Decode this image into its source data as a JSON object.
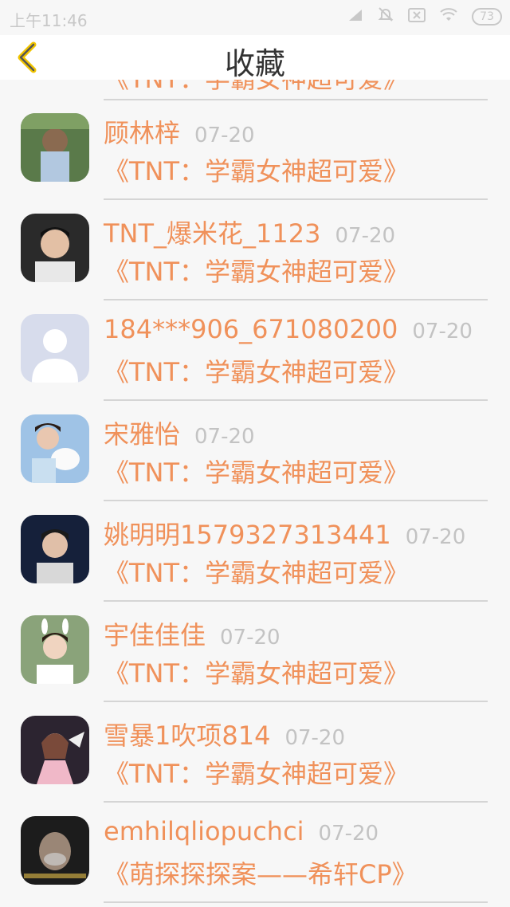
{
  "status_bar": {
    "time": "上午11:46",
    "battery": "73"
  },
  "header": {
    "title": "收藏"
  },
  "partial": {
    "subtitle": "《TNT：学霸女神超可爱》"
  },
  "items": [
    {
      "name": "顾林梓",
      "date": "07-20",
      "subtitle": "《TNT：学霸女神超可爱》"
    },
    {
      "name": "TNT_爆米花_1123",
      "date": "07-20",
      "subtitle": "《TNT：学霸女神超可爱》"
    },
    {
      "name": "184***906_671080200",
      "date": "07-20",
      "subtitle": "《TNT：学霸女神超可爱》"
    },
    {
      "name": "宋雅怡",
      "date": "07-20",
      "subtitle": "《TNT：学霸女神超可爱》"
    },
    {
      "name": "姚明明1579327313441",
      "date": "07-20",
      "subtitle": "《TNT：学霸女神超可爱》"
    },
    {
      "name": "宇佳佳佳",
      "date": "07-20",
      "subtitle": "《TNT：学霸女神超可爱》"
    },
    {
      "name": "雪暴1吹项814",
      "date": "07-20",
      "subtitle": "《TNT：学霸女神超可爱》"
    },
    {
      "name": "emhilqliopuchci",
      "date": "07-20",
      "subtitle": "《萌探探探案——希轩CP》"
    }
  ],
  "colors": {
    "accent": "#f0915a",
    "date": "#c3c3c3",
    "back_icon": "#f2c500"
  }
}
